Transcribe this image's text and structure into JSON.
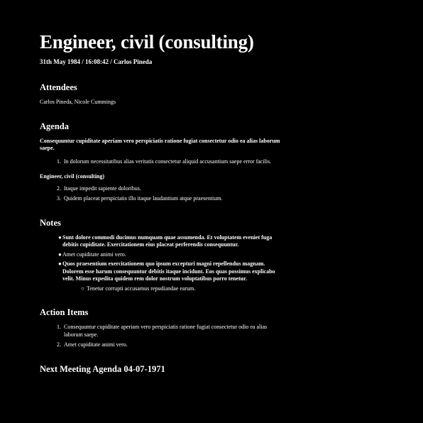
{
  "title": "Engineer, civil (consulting)",
  "meta": "31th May 1984 / 16:08:42 / Carlos Pineda",
  "attendees": {
    "heading": "Attendees",
    "names": "Carlos Pineda, Nicole Cummings"
  },
  "agenda": {
    "heading": "Agenda",
    "intro": "Consequuntur cupiditate aperiam vero perspiciatis ratione fugiat consectetur odio ea alias laborum saepe.",
    "list1": [
      {
        "num": "1.",
        "text": "In dolorum necessitatibus alias veritatis consectetur aliquid accusantium saepe error facilis."
      }
    ],
    "subheading": "Engineer, civil (consulting)",
    "list2": [
      {
        "num": "2.",
        "text": "Itaque impedit sapiente doloribus."
      },
      {
        "num": "3.",
        "text": "Quidem placeat perspiciatis illo itaque laudantium atque praesentium."
      }
    ]
  },
  "notes": {
    "heading": "Notes",
    "bullet_glyph": "●",
    "sub_glyph": "○",
    "items": [
      {
        "text": "Sunt dolore commodi ducimus numquam quae assumenda. Et voluptatem eveniet fuga debitis cupiditate. Exercitationem eius placeat perferendis consequuntur."
      },
      {
        "text": "Amet cupiditate animi vero."
      },
      {
        "text": "Quos praesentium exercitationem quo ipsum excepturi magni repellendus magnam. Dolorem esse harum consequuntur debitis itaque incidunt. Eos quas possimus explicabo velit. Minus expedita quidem rem dolor nostrum voluptatibus porro tenetur."
      }
    ],
    "sub_items": [
      {
        "text": "Tenetur corrupti accusamus repudiandae earum."
      }
    ]
  },
  "action_items": {
    "heading": "Action Items",
    "items": [
      {
        "num": "1.",
        "text": "Consequuntur cupiditate aperiam vero perspiciatis ratione fugiat consectetur odio ea alias laborum saepe."
      },
      {
        "num": "2.",
        "text": "Amet cupiditate animi vero."
      }
    ]
  },
  "next_meeting": {
    "heading": "Next Meeting Agenda 04-07-1971"
  }
}
